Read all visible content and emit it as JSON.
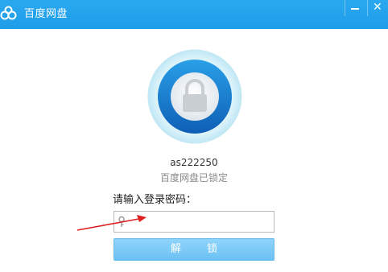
{
  "window": {
    "title": "百度网盘"
  },
  "title_buttons": {
    "minimize_icon": "minimize-icon",
    "close_icon": "close-icon"
  },
  "lock": {
    "icon": "padlock-icon",
    "ring_color": "#1e88d8",
    "outer_color": "#e4f6fb"
  },
  "account": {
    "username": "as222250",
    "status": "百度网盘已锁定"
  },
  "login": {
    "password_label": "请输入登录密码：",
    "password_value": "",
    "unlock_label": "解 锁"
  },
  "colors": {
    "titlebar": "#1e9de9",
    "unlock_button": "#7ccaf7",
    "annotation_arrow": "#e02020"
  }
}
